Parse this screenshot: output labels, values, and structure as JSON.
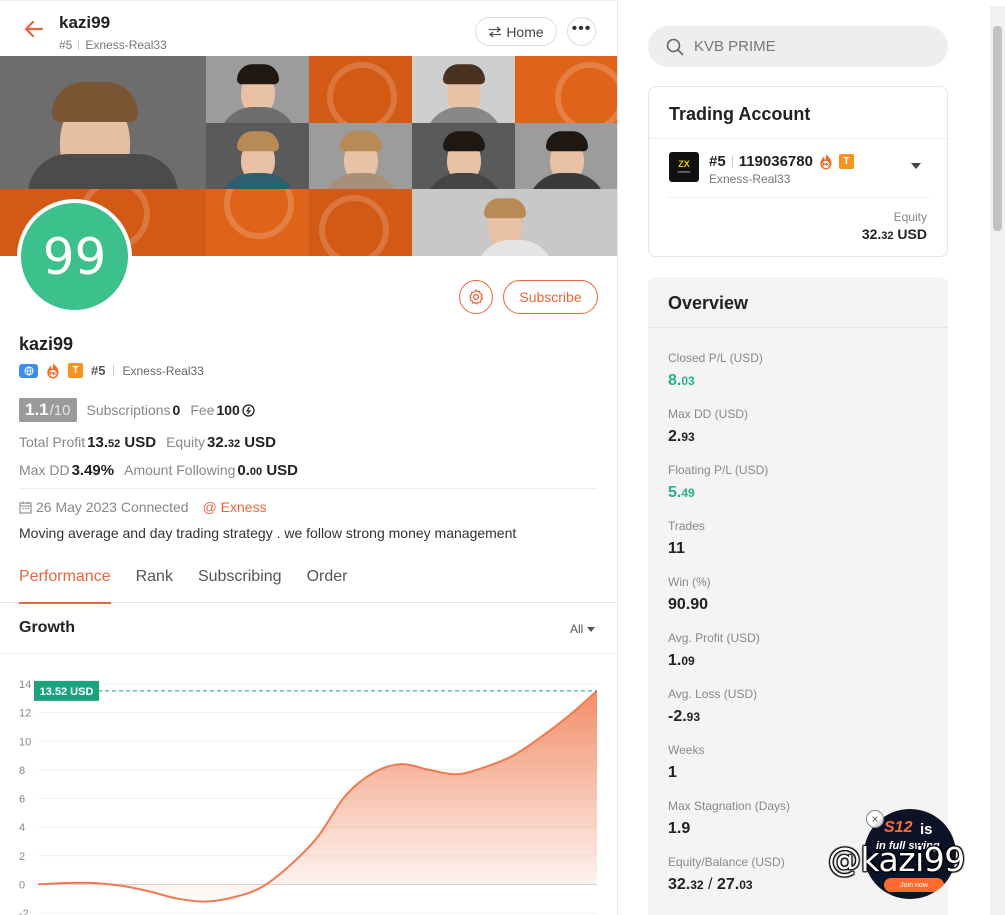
{
  "header": {
    "name": "kazi99",
    "rank": "#5",
    "server": "Exness-Real33",
    "home_label": "Home",
    "more_label": "•••"
  },
  "profile": {
    "avatar_text": "99",
    "name": "kazi99",
    "badge_rank": "#5",
    "badge_server": "Exness-Real33",
    "fire_text": "PK",
    "t_text": "T",
    "subscribe_label": "Subscribe",
    "score": "1.1",
    "score_max": "/10",
    "subscriptions_label": "Subscriptions",
    "subscriptions_value": "0",
    "fee_label": "Fee",
    "fee_value": "100",
    "total_profit_label": "Total Profit",
    "total_profit_int": "13.",
    "total_profit_dec": "52",
    "total_profit_unit": " USD",
    "equity_label": "Equity",
    "equity_int": "32.",
    "equity_dec": "32",
    "equity_unit": " USD",
    "maxdd_label": "Max DD",
    "maxdd_value": "3.49%",
    "amount_following_label": "Amount Following",
    "amount_following_int": "0.",
    "amount_following_dec": "00",
    "amount_following_unit": " USD",
    "connected_text": "26 May 2023 Connected",
    "broker": "@ Exness",
    "description": "Moving average and day trading strategy . we follow strong money management"
  },
  "tabs": [
    "Performance",
    "Rank",
    "Subscribing",
    "Order"
  ],
  "growth": {
    "title": "Growth",
    "range": "All",
    "current_label": "13.52 USD"
  },
  "chart_data": {
    "type": "area",
    "title": "",
    "xlabel": "",
    "ylabel": "",
    "ylim": [
      -2,
      14
    ],
    "yticks": [
      14,
      12,
      10,
      8,
      6,
      4,
      2,
      0,
      -2
    ],
    "x": [
      0,
      0.05,
      0.1,
      0.15,
      0.2,
      0.25,
      0.3,
      0.35,
      0.4,
      0.45,
      0.5,
      0.55,
      0.6,
      0.65,
      0.7,
      0.75,
      0.8,
      0.85,
      0.9,
      0.95,
      1.0
    ],
    "values": [
      0,
      0.1,
      0.1,
      -0.1,
      -0.5,
      -1.0,
      -1.2,
      -0.9,
      -0.2,
      1.3,
      3.3,
      6.2,
      7.8,
      8.4,
      8.0,
      7.7,
      8.2,
      9.0,
      10.3,
      11.8,
      13.52
    ],
    "reference_line": 13.52,
    "grid": true,
    "color": "#f07a4f"
  },
  "search": {
    "placeholder": "KVB PRIME"
  },
  "trading_account": {
    "title": "Trading Account",
    "rank": "#5",
    "account_no": "119036780",
    "server": "Exness-Real33",
    "logo_mark": "ZX",
    "logo_name": "exness",
    "equity_label": "Equity",
    "equity_int": "32.",
    "equity_dec": "32",
    "equity_unit": " USD"
  },
  "overview": {
    "title": "Overview",
    "items": [
      {
        "label": "Closed P/L (USD)",
        "int": "8.",
        "dec": "03",
        "green": true
      },
      {
        "label": "Max DD (USD)",
        "int": "2.",
        "dec": "93",
        "green": false
      },
      {
        "label": "Floating P/L (USD)",
        "int": "5.",
        "dec": "49",
        "green": true
      },
      {
        "label": "Trades",
        "int": "11",
        "dec": "",
        "green": false
      },
      {
        "label": "Win (%)",
        "int": "90.90",
        "dec": "",
        "green": false
      },
      {
        "label": "Avg. Profit (USD)",
        "int": "1.",
        "dec": "09",
        "green": false
      },
      {
        "label": "Avg. Loss (USD)",
        "int": "-2.",
        "dec": "93",
        "green": false
      },
      {
        "label": "Weeks",
        "int": "1",
        "dec": "",
        "green": false
      },
      {
        "label": "Max Stagnation (Days)",
        "int": "1.9",
        "dec": "",
        "green": false
      }
    ],
    "equity_balance_label": "Equity/Balance (USD)",
    "equity_balance": {
      "a_int": "32.",
      "a_dec": "32",
      "sep": " / ",
      "b_int": "27.",
      "b_dec": "03"
    }
  },
  "promo": {
    "s12": "S12",
    "is": "is",
    "full_swing": "in full swing",
    "join": "Join now",
    "close": "×"
  },
  "watermark": "@kazi99",
  "colors": {
    "accent": "#e8663c",
    "green": "#3cc08c",
    "profit": "#23b38c",
    "teal_label": "#1aa37f"
  }
}
